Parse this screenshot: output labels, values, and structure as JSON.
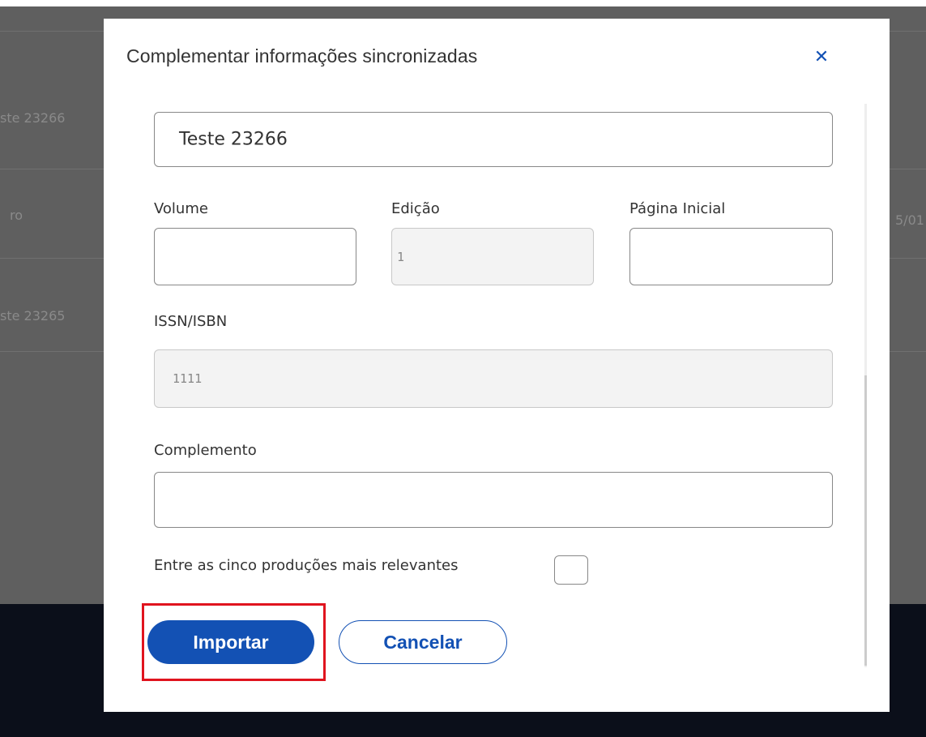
{
  "background": {
    "row_texts": [
      "ste 23266",
      "ro",
      "ste 23265",
      "5/01"
    ]
  },
  "modal": {
    "title": "Complementar informações sincronizadas",
    "close_icon": "close-icon",
    "fields": {
      "title_value": "Teste 23266",
      "volume_label": "Volume",
      "volume_value": "",
      "edicao_label": "Edição",
      "edicao_value": "1",
      "pagina_label": "Página Inicial",
      "pagina_value": "",
      "issn_label": "ISSN/ISBN",
      "issn_value": "1111",
      "complemento_label": "Complemento",
      "complemento_value": "",
      "relevantes_label": "Entre as cinco produções mais relevantes",
      "relevantes_checked": false
    },
    "buttons": {
      "import_label": "Importar",
      "cancel_label": "Cancelar"
    }
  },
  "colors": {
    "primary": "#1351b4",
    "highlight": "#e0141e",
    "overlay": "#5f5f5f",
    "footer": "#0b0f1a"
  }
}
